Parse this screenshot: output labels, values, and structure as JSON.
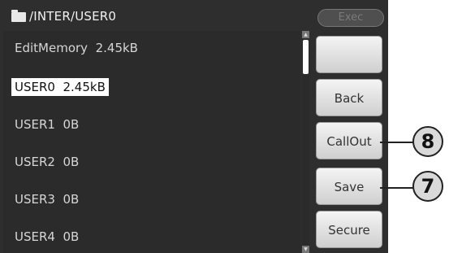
{
  "header": {
    "path": "/INTER/USER0",
    "exec_label": "Exec"
  },
  "file_list": {
    "items": [
      {
        "label": "EditMemory  2.45kB",
        "selected": false
      },
      {
        "label": "USER0  2.45kB",
        "selected": true
      },
      {
        "label": "USER1  0B",
        "selected": false
      },
      {
        "label": "USER2  0B",
        "selected": false
      },
      {
        "label": "USER3  0B",
        "selected": false
      },
      {
        "label": "USER4  0B",
        "selected": false
      }
    ]
  },
  "side_buttons": {
    "blank_label": "",
    "back_label": "Back",
    "callout_label": "CallOut",
    "save_label": "Save",
    "secure_label": "Secure"
  },
  "annotations": {
    "callout_number": "8",
    "save_number": "7"
  },
  "colors": {
    "screen_background": "#2e2e2e",
    "selected_row": "#ffffff",
    "button_face": "#e2e2e2"
  }
}
